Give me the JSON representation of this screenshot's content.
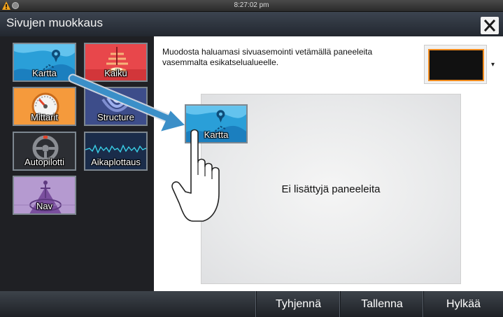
{
  "status_bar": {
    "clock": "8:27:02 pm",
    "alert_icon": "warning-triangle-icon",
    "globe_icon": "globe-icon"
  },
  "title_bar": {
    "title": "Sivujen muokkaus",
    "close_icon": "close-icon"
  },
  "panels": [
    {
      "label": "Kartta",
      "icon": "chart-icon",
      "color": "#2aa7e0"
    },
    {
      "label": "Kaiku",
      "icon": "echo-icon",
      "color": "#e8474b"
    },
    {
      "label": "Mittarit",
      "icon": "gauge-icon",
      "color": "#f59a3c"
    },
    {
      "label": "Structure",
      "icon": "structure-icon",
      "color": "#3d4d8a"
    },
    {
      "label": "Autopilotti",
      "icon": "steering-wheel-icon",
      "color": "#2c2e33"
    },
    {
      "label": "Aikaplottaus",
      "icon": "waveform-icon",
      "color": "#1a2c4a"
    },
    {
      "label": "Nav",
      "icon": "nav-icon",
      "color": "#8a6aa8"
    }
  ],
  "workspace": {
    "instructions_line1": "Muodosta haluamasi sivuasemointi vetämällä paneeleita",
    "instructions_line2": "vasemmalta esikatselualueelle.",
    "preview_dropdown": "▾",
    "empty_text": "Ei lisättyjä paneeleita",
    "dragged_panel": "Kartta"
  },
  "bottom_bar": {
    "clear_label": "Tyhjennä",
    "save_label": "Tallenna",
    "discard_label": "Hylkää"
  },
  "colors": {
    "accent": "#2aa7e0",
    "preview_border": "#f28c1e"
  }
}
